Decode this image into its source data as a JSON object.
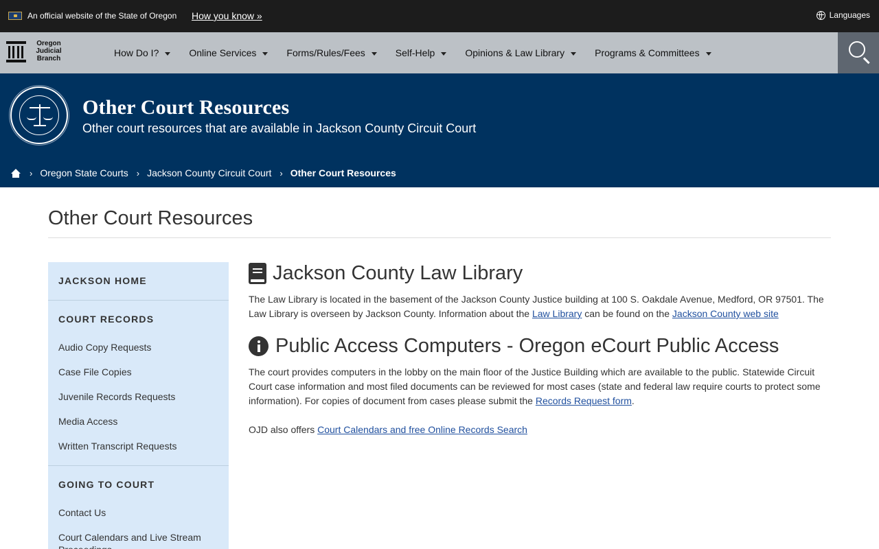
{
  "official_bar": {
    "text": "An official website of the State of Oregon",
    "how_you_know": "How you know »",
    "languages": "Languages"
  },
  "logo": {
    "line1": "Oregon",
    "line2": "Judicial",
    "line3": "Branch"
  },
  "nav": {
    "items": [
      {
        "label": "How Do I?"
      },
      {
        "label": "Online Services"
      },
      {
        "label": "Forms/Rules/Fees"
      },
      {
        "label": "Self-Help"
      },
      {
        "label": "Opinions & Law Library"
      },
      {
        "label": "Programs & Committees"
      }
    ]
  },
  "hero": {
    "title": "Other Court Resources",
    "subtitle": "Other court resources that are available in Jackson County Circuit Court"
  },
  "breadcrumb": {
    "items": [
      "Oregon State Courts",
      "Jackson County Circuit Court"
    ],
    "current": "Other Court Resources"
  },
  "page_title": "Other Court Resources",
  "sidebar": {
    "home": "JACKSON HOME",
    "court_records": {
      "heading": "COURT RECORDS",
      "links": [
        "Audio Copy Requests",
        "Case File Copies",
        "Juvenile Records Requests",
        "Media Access",
        "Written Transcript Requests"
      ]
    },
    "going_to_court": {
      "heading": "GOING TO COURT",
      "links": [
        "Contact Us",
        "Court Calendars and Live Stream Proceedings"
      ]
    }
  },
  "main": {
    "law_library": {
      "title": "Jackson County Law Library",
      "text1": "The Law Library is located in the basement of the Jackson County Justice building at 100 S. Oakdale Avenue, Medford, OR 97501. The Law Library is overseen by Jackson County. Information about the ",
      "link1": "Law Library",
      "text2": " can be found on the ",
      "link2": "Jackson County web site"
    },
    "public_access": {
      "title": "Public Access Computers - Oregon eCourt Public Access",
      "text1": "The court provides computers in the lobby on the main floor of the Justice Building which are available to the public. Statewide Circuit Court case information and most filed documents can be reviewed for most cases (state and federal law require courts to protect some information). For copies of document from cases please submit the ",
      "link1": "Records Request form",
      "text2": ".",
      "offers_text": "OJD also offers ",
      "offers_link": "Court Calendars and free Online Records Search"
    }
  }
}
